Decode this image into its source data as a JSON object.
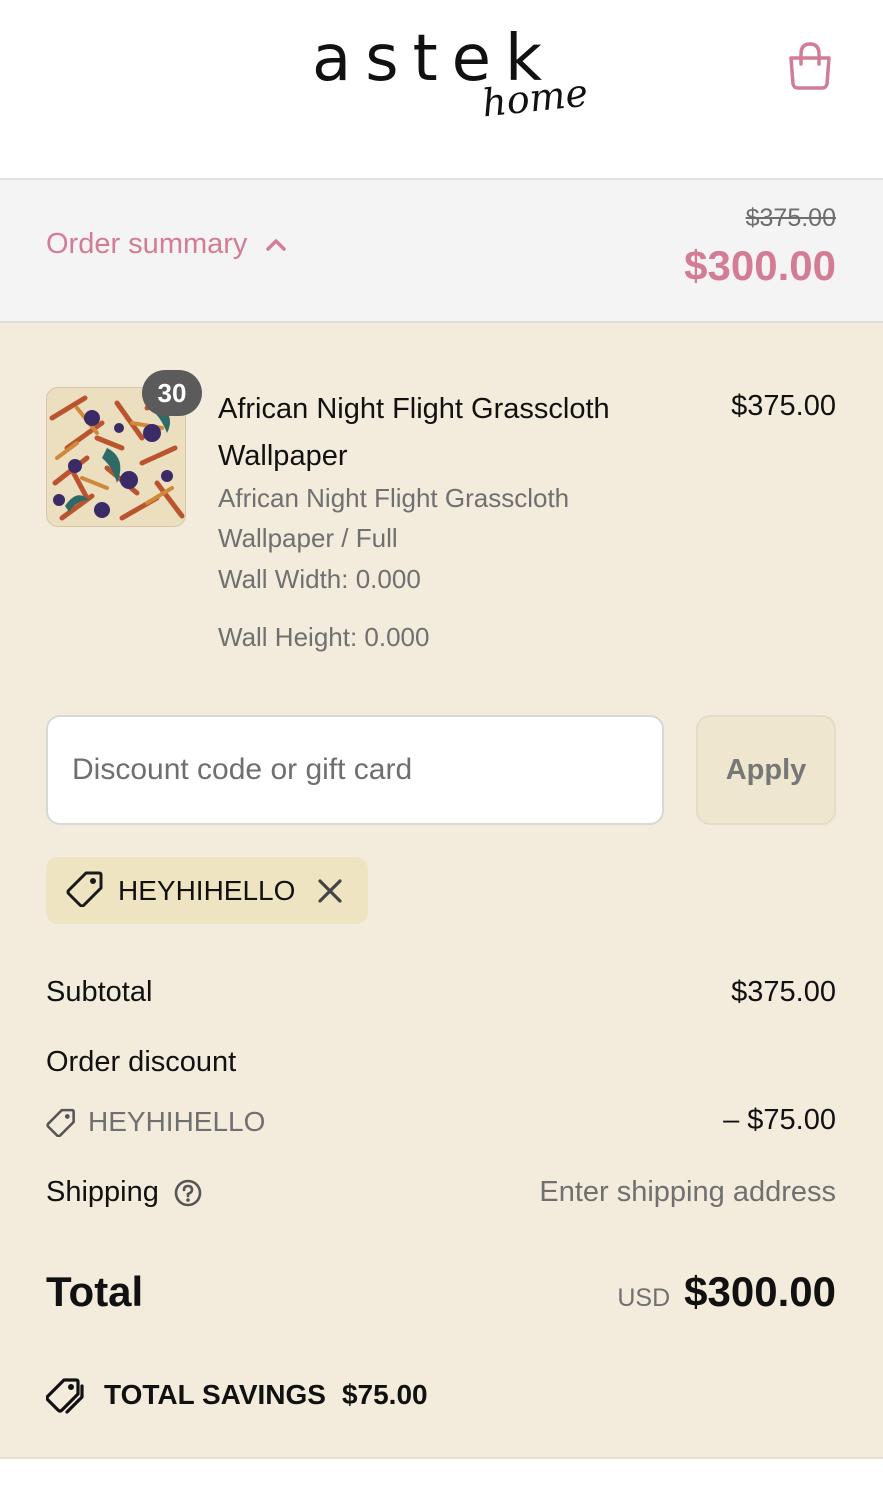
{
  "header": {
    "logo_main": "astek",
    "logo_sub": "home",
    "cart_icon": "shopping-bag-icon"
  },
  "summary_bar": {
    "toggle_label": "Order summary",
    "toggle_icon": "chevron-up-icon",
    "original_price": "$375.00",
    "discounted_price": "$300.00",
    "accent_color": "#d27c95"
  },
  "line_item": {
    "quantity": "30",
    "title": "African Night Flight Grasscloth Wallpaper",
    "price": "$375.00",
    "variant": "African Night Flight Grasscloth Wallpaper / Full",
    "properties": [
      "Wall Width: 0.000",
      "Wall Height: 0.000"
    ]
  },
  "discount": {
    "placeholder": "Discount code or gift card",
    "apply_label": "Apply",
    "applied_code": "HEYHIHELLO",
    "tag_icon": "tag-icon",
    "remove_icon": "close-icon"
  },
  "totals": {
    "subtotal_label": "Subtotal",
    "subtotal_value": "$375.00",
    "order_discount_label": "Order discount",
    "order_discount_code": "HEYHIHELLO",
    "order_discount_value": "– $75.00",
    "shipping_label": "Shipping",
    "shipping_value": "Enter shipping address",
    "total_label": "Total",
    "currency": "USD",
    "total_value": "$300.00",
    "savings_label": "TOTAL SAVINGS",
    "savings_value": "$75.00"
  },
  "colors": {
    "summary_background": "#f4f4f4",
    "content_background": "#f3ecdc",
    "chip_background": "#efe4c2"
  }
}
